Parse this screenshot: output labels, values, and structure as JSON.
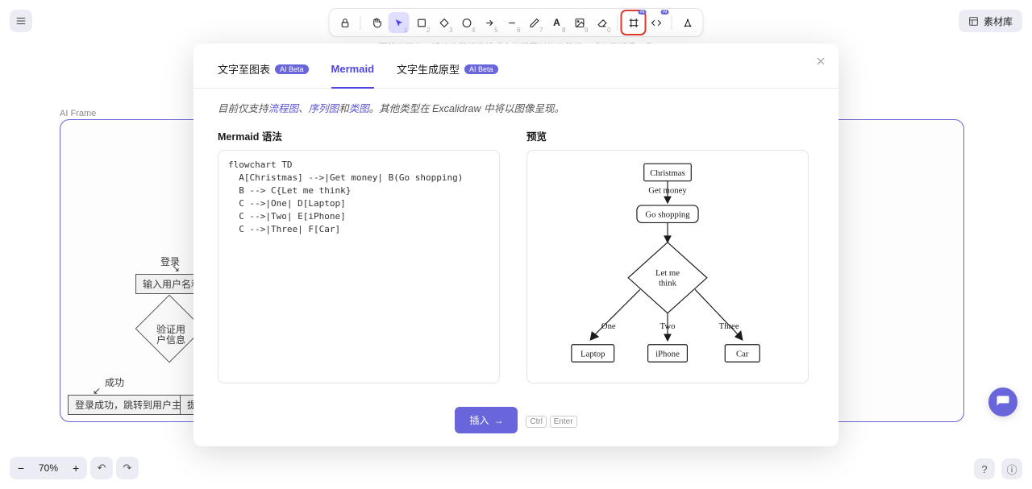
{
  "header": {
    "library_label": "素材库"
  },
  "hint_text": "要移动画布，请按住鼠标滚轮或空格键同时拖动鼠标，或使用抓手工具",
  "toolbar": {
    "tools": [
      "lock",
      "hand",
      "select",
      "rect",
      "diamond",
      "circle",
      "arrow",
      "line",
      "draw",
      "text",
      "image",
      "eraser",
      "frame",
      "embed",
      "other"
    ],
    "active": "select"
  },
  "canvas": {
    "frame_label": "AI Frame",
    "bg_nodes": {
      "login": "登录",
      "input": "输入用户名和密码",
      "verify_top": "验证用",
      "verify_bottom": "户信息",
      "success": "成功",
      "success_box": "登录成功，跳转到用户主页",
      "hint": "提示"
    }
  },
  "zoom": {
    "level": "70%"
  },
  "modal": {
    "tabs": {
      "t1": "文字至图表",
      "t2": "Mermaid",
      "t3": "文字生成原型"
    },
    "ai_label": "AI Beta",
    "support": {
      "prefix": "目前仅支持",
      "link1": "流程图",
      "sep1": "、",
      "link2": "序列图",
      "mid": "和",
      "link3": "类图",
      "suffix": "。其他类型在 Excalidraw 中将以图像呈现。"
    },
    "syntax_label": "Mermaid 语法",
    "preview_label": "预览",
    "code": "flowchart TD\n  A[Christmas] -->|Get money| B(Go shopping)\n  B --> C{Let me think}\n  C -->|One| D[Laptop]\n  C -->|Two| E[iPhone]\n  C -->|Three| F[Car]",
    "insert": "插入",
    "kbd1": "Ctrl",
    "kbd2": "Enter"
  },
  "chart_data": {
    "type": "flowchart",
    "direction": "TD",
    "nodes": [
      {
        "id": "A",
        "label": "Christmas",
        "shape": "rect"
      },
      {
        "id": "B",
        "label": "Go shopping",
        "shape": "round"
      },
      {
        "id": "C",
        "label": "Let me think",
        "shape": "diamond"
      },
      {
        "id": "D",
        "label": "Laptop",
        "shape": "rect"
      },
      {
        "id": "E",
        "label": "iPhone",
        "shape": "rect"
      },
      {
        "id": "F",
        "label": "Car",
        "shape": "rect"
      }
    ],
    "edges": [
      {
        "from": "A",
        "to": "B",
        "label": "Get money"
      },
      {
        "from": "B",
        "to": "C",
        "label": ""
      },
      {
        "from": "C",
        "to": "D",
        "label": "One"
      },
      {
        "from": "C",
        "to": "E",
        "label": "Two"
      },
      {
        "from": "C",
        "to": "F",
        "label": "Three"
      }
    ]
  }
}
